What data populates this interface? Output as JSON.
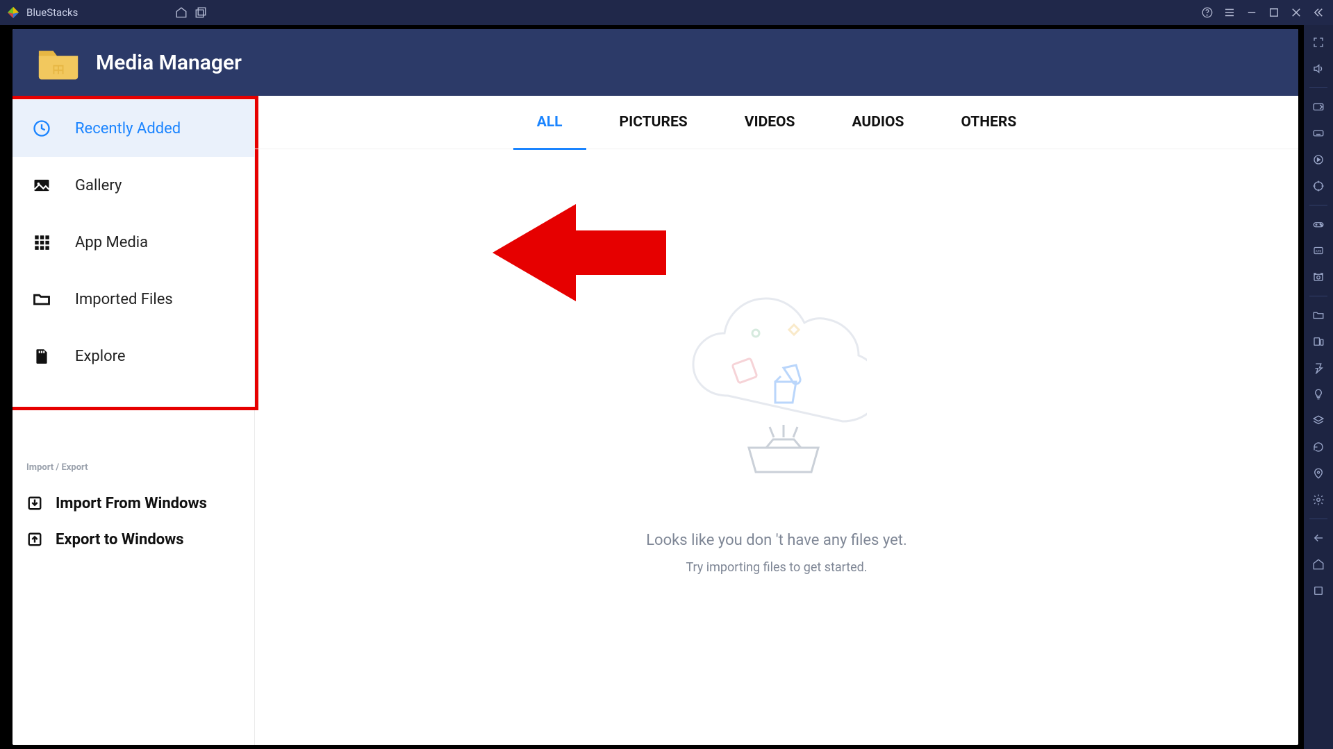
{
  "app_name": "BlueStacks",
  "header": {
    "title": "Media Manager"
  },
  "sidebar": {
    "items": [
      {
        "label": "Recently Added"
      },
      {
        "label": "Gallery"
      },
      {
        "label": "App Media"
      },
      {
        "label": "Imported Files"
      },
      {
        "label": "Explore"
      }
    ]
  },
  "import_export": {
    "section_label": "Import / Export",
    "import_label": "Import From Windows",
    "export_label": "Export to Windows"
  },
  "tabs": {
    "all": "ALL",
    "pictures": "PICTURES",
    "videos": "VIDEOS",
    "audios": "AUDIOS",
    "others": "OTHERS"
  },
  "empty": {
    "title": "Looks like you don 't have any files yet.",
    "subtitle": "Try importing files to get started."
  }
}
